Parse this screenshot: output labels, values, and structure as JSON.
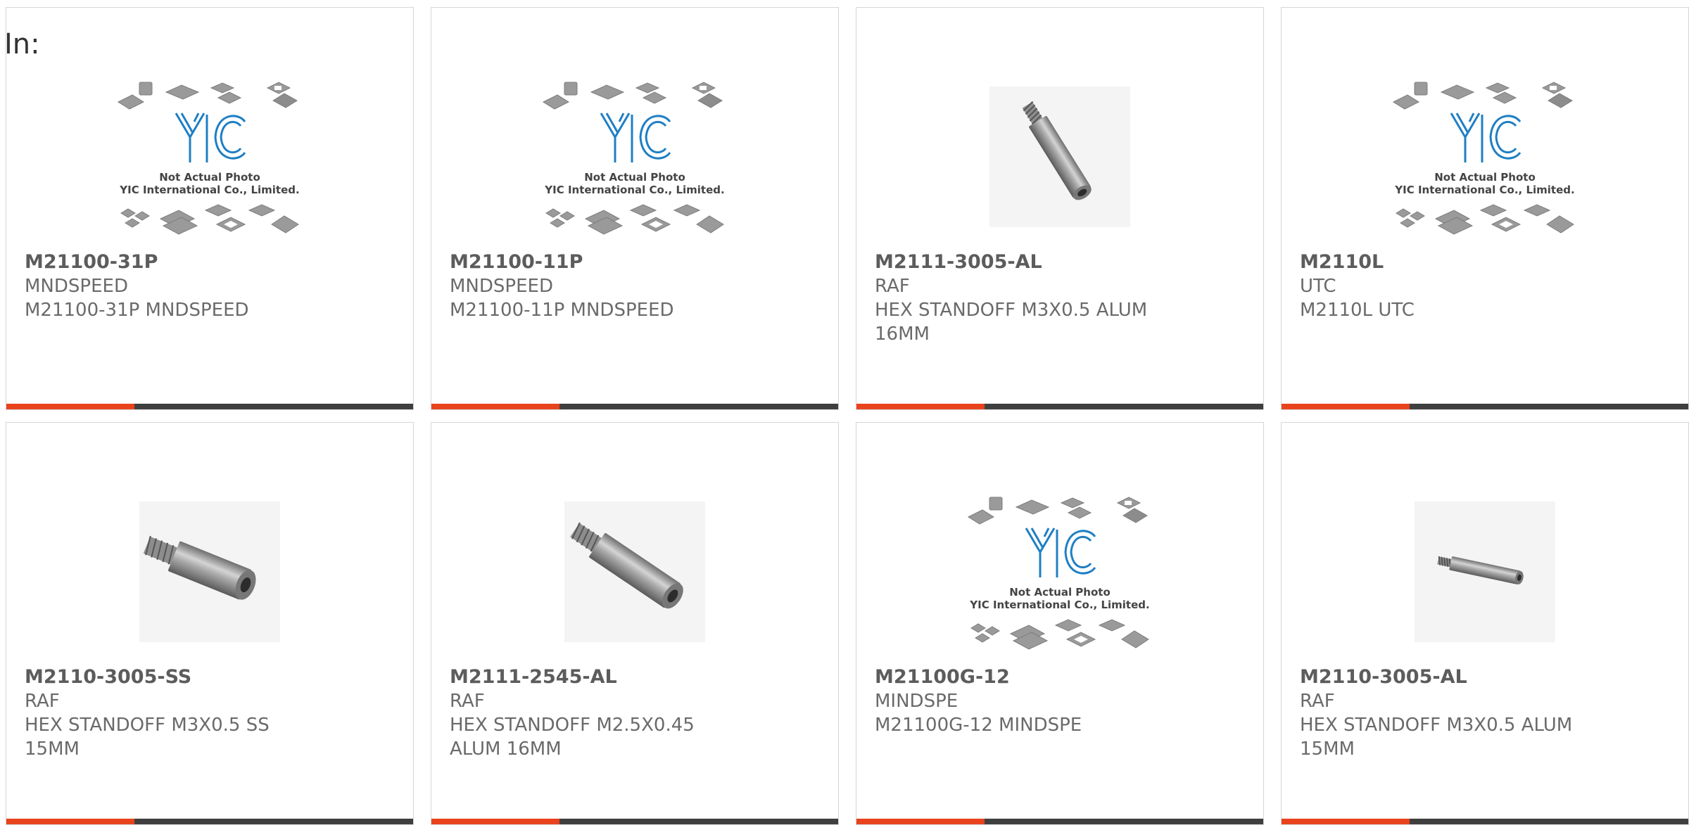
{
  "header": {
    "label": "In:"
  },
  "products": [
    {
      "part_number": "M21100-31P",
      "manufacturer": "MNDSPEED",
      "description": "M21100-31P MNDSPEED",
      "image": "yic",
      "image_text": [
        "Not Actual Photo",
        "YIC International Co., Limited."
      ]
    },
    {
      "part_number": "M21100-11P",
      "manufacturer": "MNDSPEED",
      "description": "M21100-11P MNDSPEED",
      "image": "yic",
      "image_text": [
        "Not Actual Photo",
        "YIC International Co., Limited."
      ]
    },
    {
      "part_number": "M2111-3005-AL",
      "manufacturer": "RAF",
      "description": "HEX STANDOFF M3X0.5 ALUM 16MM",
      "image": "standoff-long"
    },
    {
      "part_number": "M2110L",
      "manufacturer": "UTC",
      "description": "M2110L UTC",
      "image": "yic",
      "image_text": [
        "Not Actual Photo",
        "YIC International Co., Limited."
      ]
    },
    {
      "part_number": "M2110-3005-SS",
      "manufacturer": "RAF",
      "description": "HEX STANDOFF M3X0.5 SS 15MM",
      "image": "standoff-short"
    },
    {
      "part_number": "M2111-2545-AL",
      "manufacturer": "RAF",
      "description": "HEX STANDOFF M2.5X0.45 ALUM 16MM",
      "image": "standoff-mid"
    },
    {
      "part_number": "M21100G-12",
      "manufacturer": "MINDSPE",
      "description": "M21100G-12 MINDSPE",
      "image": "yic",
      "image_text": [
        "Not Actual Photo",
        "YIC International Co., Limited."
      ]
    },
    {
      "part_number": "M2110-3005-AL",
      "manufacturer": "RAF",
      "description": "HEX STANDOFF M3X0.5 ALUM 15MM",
      "image": "standoff-small"
    }
  ],
  "colors": {
    "accent": "#e8431d",
    "bar": "#3f3f3f",
    "logo": "#1f7fc4"
  }
}
